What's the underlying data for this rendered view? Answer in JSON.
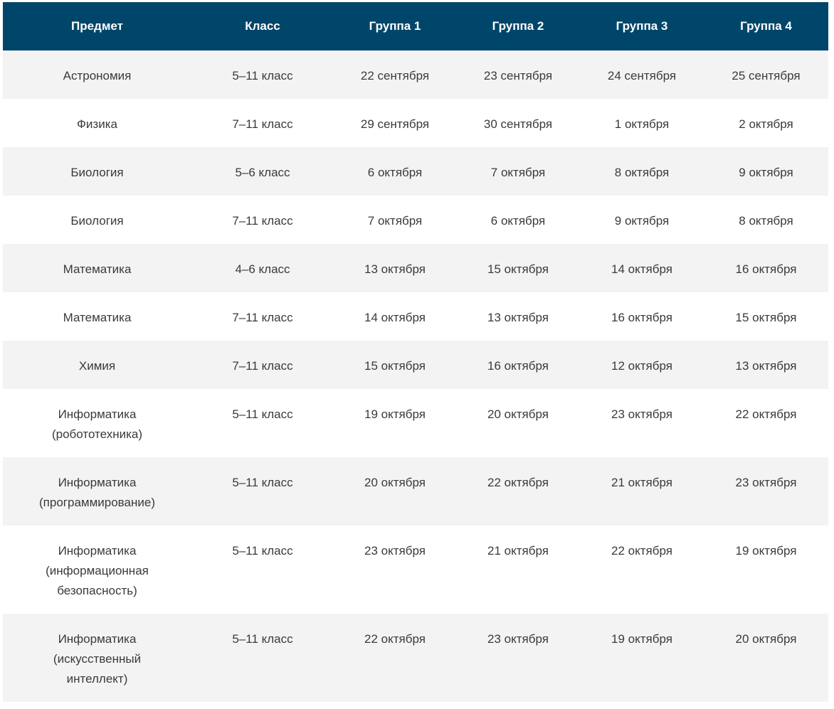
{
  "header": {
    "subject": "Предмет",
    "class": "Класс",
    "group1": "Группа 1",
    "group2": "Группа 2",
    "group3": "Группа 3",
    "group4": "Группа 4"
  },
  "rows": [
    {
      "subject": [
        "Астрономия"
      ],
      "class": "5–11 класс",
      "g1": "22 сентября",
      "g2": "23 сентября",
      "g3": "24 сентября",
      "g4": "25 сентября"
    },
    {
      "subject": [
        "Физика"
      ],
      "class": "7–11 класс",
      "g1": "29 сентября",
      "g2": "30 сентября",
      "g3": "1 октября",
      "g4": "2 октября"
    },
    {
      "subject": [
        "Биология"
      ],
      "class": "5–6 класс",
      "g1": "6 октября",
      "g2": "7 октября",
      "g3": "8 октября",
      "g4": "9 октября"
    },
    {
      "subject": [
        "Биология"
      ],
      "class": "7–11 класс",
      "g1": "7 октября",
      "g2": "6 октября",
      "g3": "9 октября",
      "g4": "8 октября"
    },
    {
      "subject": [
        "Математика"
      ],
      "class": "4–6 класс",
      "g1": "13 октября",
      "g2": "15 октября",
      "g3": "14 октября",
      "g4": "16 октября"
    },
    {
      "subject": [
        "Математика"
      ],
      "class": "7–11 класс",
      "g1": "14 октября",
      "g2": "13 октября",
      "g3": "16 октября",
      "g4": "15 октября"
    },
    {
      "subject": [
        "Химия"
      ],
      "class": "7–11 класс",
      "g1": "15 октября",
      "g2": "16 октября",
      "g3": "12 октября",
      "g4": "13 октября"
    },
    {
      "subject": [
        "Информатика",
        "(робототехника)"
      ],
      "class": "5–11 класс",
      "g1": "19 октября",
      "g2": "20 октября",
      "g3": "23 октября",
      "g4": "22 октября"
    },
    {
      "subject": [
        "Информатика",
        "(программирование)"
      ],
      "class": "5–11 класс",
      "g1": "20 октября",
      "g2": "22 октября",
      "g3": "21 октября",
      "g4": "23 октября"
    },
    {
      "subject": [
        "Информатика",
        "(информационная",
        "безопасность)"
      ],
      "class": "5–11 класс",
      "g1": "23 октября",
      "g2": "21 октября",
      "g3": "22 октября",
      "g4": "19 октября"
    },
    {
      "subject": [
        "Информатика",
        "(искусственный",
        "интеллект)"
      ],
      "class": "5–11 класс",
      "g1": "22 октября",
      "g2": "23 октября",
      "g3": "19 октября",
      "g4": "20 октября"
    }
  ],
  "colors": {
    "header_bg": "#00466a",
    "header_text": "#ffffff",
    "row_alt_bg": "#f3f3f3",
    "row_bg": "#ffffff",
    "cell_text": "#3a3a3a"
  }
}
